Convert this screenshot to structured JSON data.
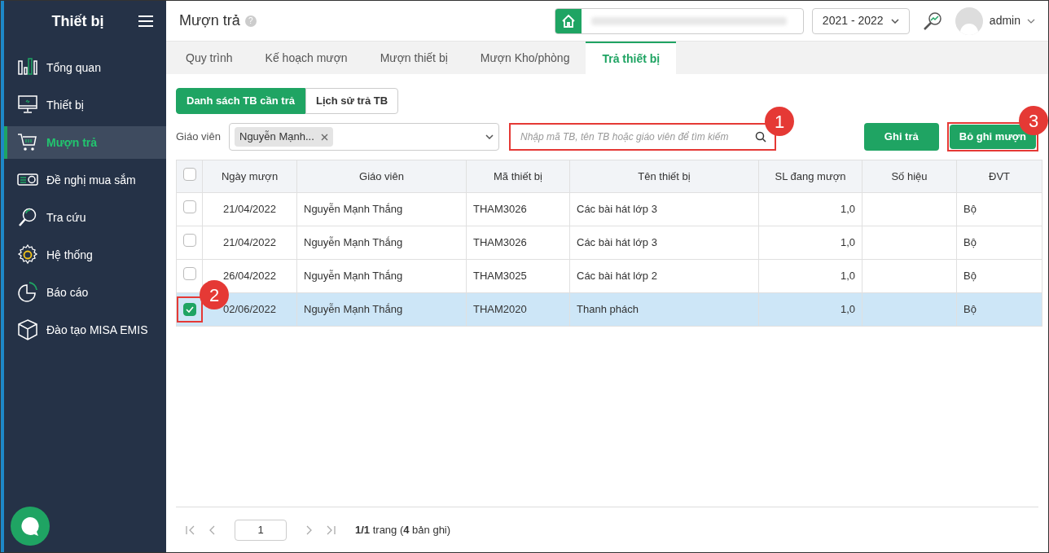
{
  "sidebar": {
    "title": "Thiết bị",
    "items": [
      {
        "label": "Tổng quan",
        "selected": false
      },
      {
        "label": "Thiết bị",
        "selected": false
      },
      {
        "label": "Mượn trả",
        "selected": true
      },
      {
        "label": "Đề nghị mua sắm",
        "selected": false
      },
      {
        "label": "Tra cứu",
        "selected": false
      },
      {
        "label": "Hệ thống",
        "selected": false
      },
      {
        "label": "Báo cáo",
        "selected": false
      },
      {
        "label": "Đào tạo MISA EMIS",
        "selected": false
      }
    ]
  },
  "header": {
    "title": "Mượn trả",
    "help": "?",
    "school_year": "2021 - 2022",
    "user": "admin"
  },
  "tabs": [
    {
      "label": "Quy trình",
      "selected": false
    },
    {
      "label": "Kế hoạch mượn",
      "selected": false
    },
    {
      "label": "Mượn thiết bị",
      "selected": false
    },
    {
      "label": "Mượn Kho/phòng",
      "selected": false
    },
    {
      "label": "Trả thiết bị",
      "selected": true
    }
  ],
  "subtabs": [
    {
      "label": "Danh sách TB cần trả",
      "selected": true
    },
    {
      "label": "Lịch sử trả TB",
      "selected": false
    }
  ],
  "filter": {
    "label": "Giáo viên",
    "chip": "Nguyễn Mạnh...",
    "search_placeholder": "Nhập mã TB, tên TB hoặc giáo viên để tìm kiếm"
  },
  "buttons": [
    "Ghi trả",
    "Bỏ ghi mượn"
  ],
  "callouts": [
    "1",
    "2",
    "3"
  ],
  "table": {
    "columns": [
      "Ngày mượn",
      "Giáo viên",
      "Mã thiết bị",
      "Tên thiết bị",
      "SL đang mượn",
      "Số hiệu",
      "ĐVT"
    ],
    "all_checked": false,
    "rows": [
      {
        "cells": [
          "21/04/2022",
          "Nguyễn Mạnh Thắng",
          "THAM3026",
          "Các bài hát lớp 3",
          "1,0",
          "",
          "Bộ"
        ],
        "checked": false
      },
      {
        "cells": [
          "21/04/2022",
          "Nguyễn Mạnh Thắng",
          "THAM3026",
          "Các bài hát lớp 3",
          "1,0",
          "",
          "Bộ"
        ],
        "checked": false
      },
      {
        "cells": [
          "26/04/2022",
          "Nguyễn Mạnh Thắng",
          "THAM3025",
          "Các bài hát lớp 2",
          "1,0",
          "",
          "Bộ"
        ],
        "checked": false
      },
      {
        "cells": [
          "02/06/2022",
          "Nguyễn Mạnh Thắng",
          "THAM2020",
          "Thanh phách",
          "1,0",
          "",
          "Bộ"
        ],
        "checked": true
      }
    ]
  },
  "pager": {
    "page": "1",
    "summary": "**1/1** trang (**4** bản ghi)"
  }
}
